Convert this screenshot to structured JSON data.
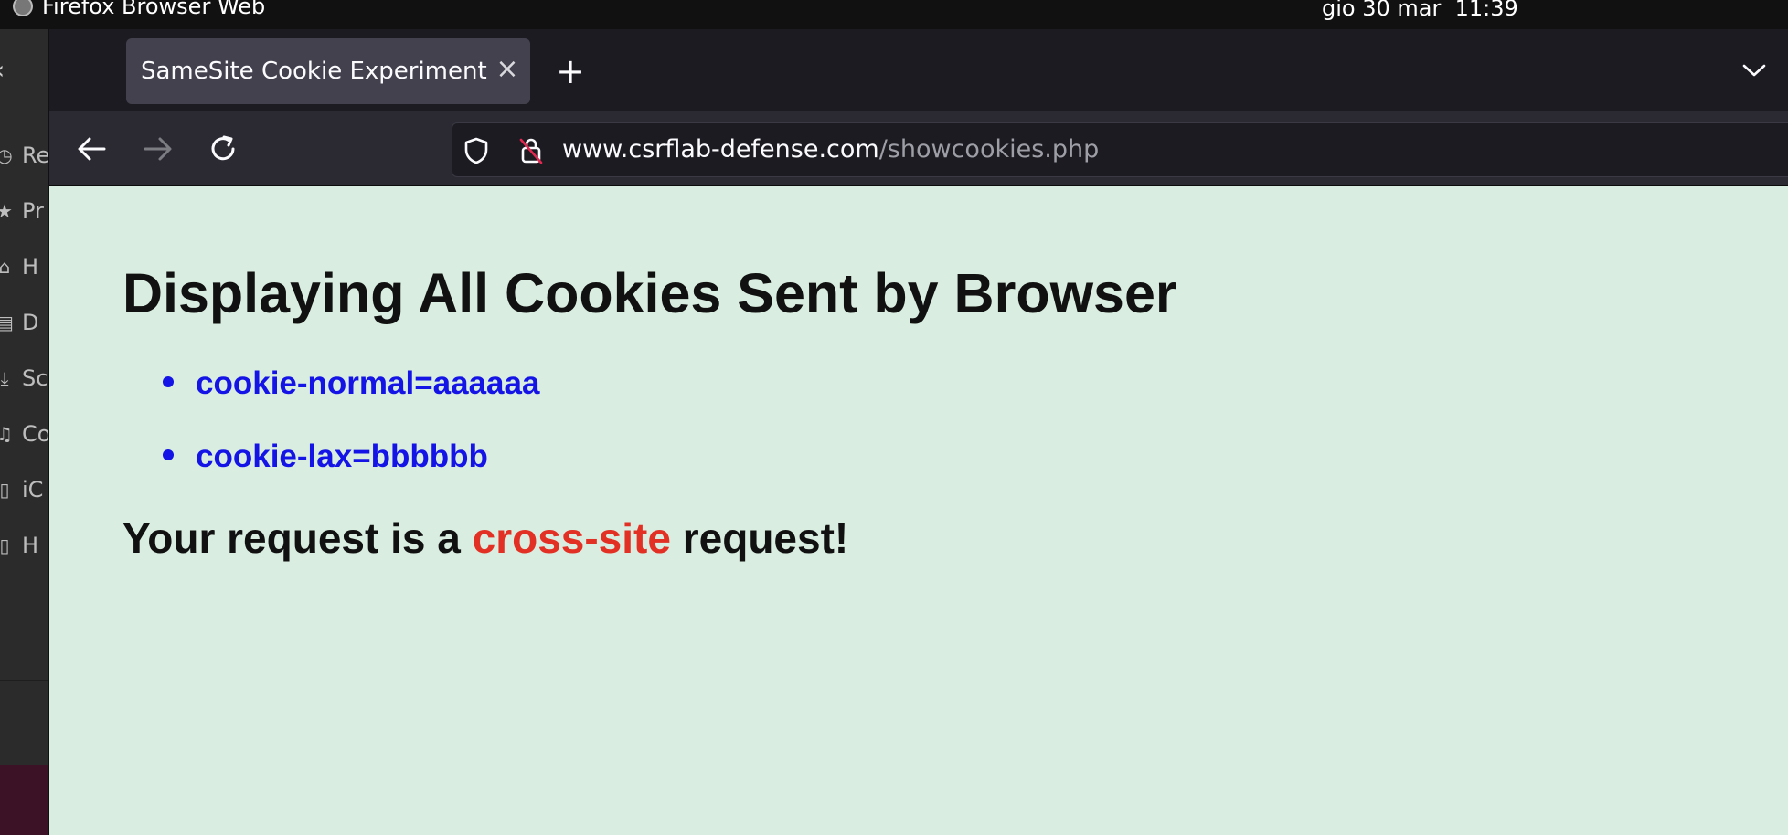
{
  "system_bar": {
    "app_name": "Firefox Browser Web",
    "clock": "gio 30 mar  11:39"
  },
  "background_window": {
    "sidebar_items": [
      {
        "label": "Re",
        "icon": "recent-icon"
      },
      {
        "label": "Pr",
        "icon": "star-icon"
      },
      {
        "label": "H",
        "icon": "home-icon"
      },
      {
        "label": "D",
        "icon": "document-icon"
      },
      {
        "label": "Sc",
        "icon": "download-icon"
      },
      {
        "label": "Co",
        "icon": "music-icon"
      },
      {
        "label": "iC",
        "icon": "drive-icon"
      },
      {
        "label": "H",
        "icon": "drive-icon"
      }
    ]
  },
  "browser": {
    "tab": {
      "title": "SameSite Cookie Experiment",
      "close": "×"
    },
    "new_tab": "+",
    "url": {
      "host": "www.csrflab-defense.com",
      "path": "/showcookies.php"
    }
  },
  "page": {
    "heading": "Displaying All Cookies Sent by Browser",
    "cookies": [
      "cookie-normal=aaaaaa",
      "cookie-lax=bbbbbb"
    ],
    "request_prefix": "Your request is a ",
    "request_highlight": "cross-site",
    "request_suffix": " request!",
    "colors": {
      "cookie_text": "#1414e6",
      "highlight": "#e33024",
      "background": "#d9ede0"
    }
  }
}
